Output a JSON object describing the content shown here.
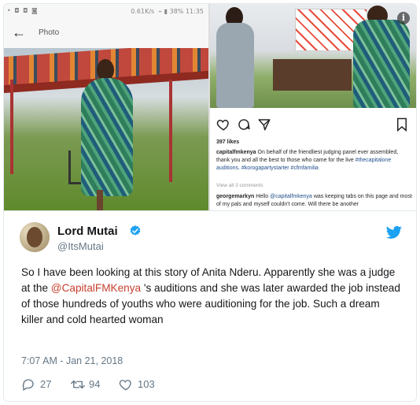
{
  "screenshot": {
    "status_time": "11:35",
    "status_speed": "0.61K/s",
    "status_battery": "38%",
    "photo_title": "Photo"
  },
  "instagram": {
    "likes": "397 likes",
    "caption_user": "capitalfmkenya",
    "caption_text": "On behalf of the friendliest judging panel ever assembled, thank you and all the best to those who came for the live",
    "caption_tags": "#thecapitalone auditions. #korogapartystarter #cfmfamilia",
    "view_all": "View all 3 comments",
    "comment_user": "georgemarkyn",
    "comment_text_1": "Hello",
    "comment_mention": "@capitalfmkenya",
    "comment_text_2": "was keeping tabs on this page and most of my pals and myself couldn't come. Will there be another"
  },
  "tweet": {
    "name": "Lord Mutai",
    "handle": "@ItsMutai",
    "text_before": "So I have been looking at this story of Anita Nderu. Apparently she was a judge at the ",
    "mention": "@CapitalFMKenya",
    "text_after": " 's auditions and she was later awarded the job instead of those hundreds of youths who were auditioning for the job. Such a dream killer and cold hearted woman",
    "timestamp": "7:07 AM - Jan 21, 2018",
    "replies": "27",
    "retweets": "94",
    "likes": "103"
  },
  "colors": {
    "twitter_blue": "#1da1f2",
    "mention_color": "#c7402f",
    "meta_gray": "#657786"
  },
  "icons": [
    "back-arrow-icon",
    "info-icon",
    "heart-outline-icon",
    "comment-icon",
    "send-icon",
    "bookmark-icon",
    "verified-badge-icon",
    "twitter-bird-icon",
    "reply-icon",
    "retweet-icon",
    "like-icon"
  ]
}
